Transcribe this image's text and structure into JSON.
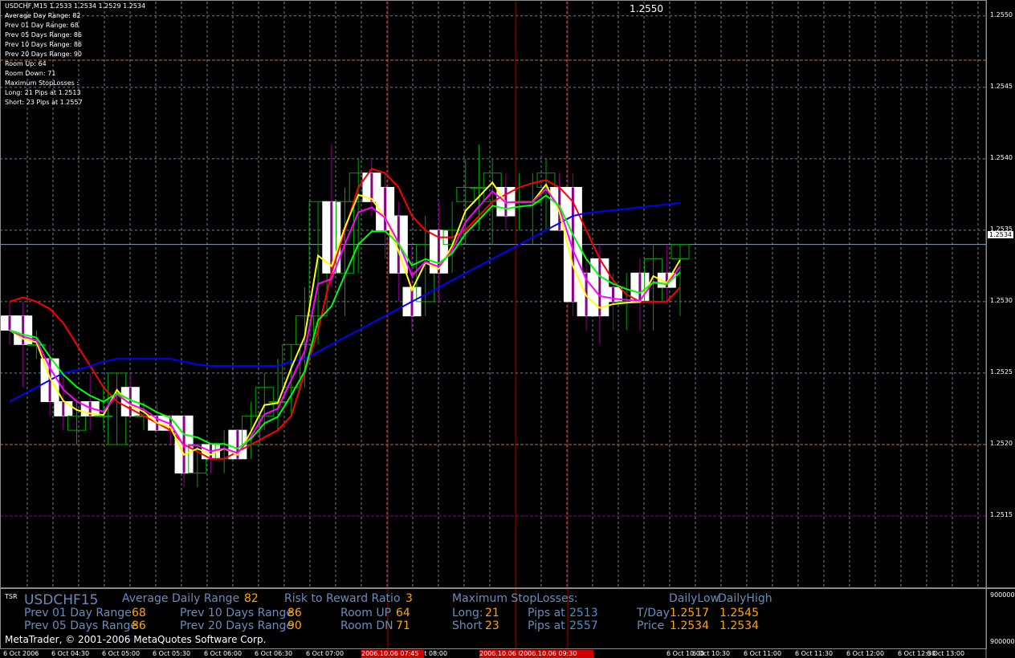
{
  "info_box": {
    "symbol_line": "USDCHF,M15  1.2533 1.2534 1.2529 1.2534",
    "lines": [
      "Average Day  Range: 82",
      "Prev 01  Day  Range: 68",
      "Prev 05  Days Range: 86",
      "Prev 10  Days Range: 86",
      "Prev 20  Days Range: 90",
      "Room Up:     64",
      "Room Down: 71",
      "Maximum StopLosses :",
      "Long:  21 Pips at 1.2513",
      "Short: 23 Pips at 1.2557"
    ]
  },
  "chart_top_price": "1.2550",
  "price_axis": {
    "labels": [
      "1.2550",
      "1.2545",
      "1.2540",
      "1.2535",
      "1.2530",
      "1.2525",
      "1.2520",
      "1.2515"
    ],
    "current_price": "1.2534"
  },
  "subwindow": {
    "label": "TSR",
    "scale_top": "900000",
    "scale_bottom": "900000",
    "symbol": "USDCHF",
    "period": "15",
    "avg_daily_range_label": "Average Daily Range",
    "avg_daily_range_value": "82",
    "rr_label": "Risk to Reward Ratio",
    "rr_value": "3",
    "max_sl_label": "Maximum StopLosses:",
    "daily_low_label": "DailyLow",
    "daily_high_label": "DailyHigh",
    "prev01_label": "Prev 01 Day Range",
    "prev01_value": "68",
    "prev10_label": "Prev 10 Days Range",
    "prev10_value": "86",
    "room_up_label": "Room UP",
    "room_up_value": "64",
    "long_label": "Long:",
    "long_value": "21",
    "pips_at_label": "Pips at",
    "long_price": "2513",
    "tday_label": "T/Day",
    "tday_low": "1.2517",
    "tday_high": "1.2545",
    "prev05_label": "Prev 05 Days Range",
    "prev05_value": "86",
    "prev20_label": "Prev 20 Days Range",
    "prev20_value": "90",
    "room_dn_label": "Room DN",
    "room_dn_value": "71",
    "short_label": "Short",
    "short_value": "23",
    "short_price": "2557",
    "price_label": "Price",
    "price_low": "1.2534",
    "price_high": "1.2534"
  },
  "copyright": "MetaTrader, © 2001-2006 MetaQuotes Software Corp.",
  "time_axis": {
    "labels": [
      "6 Oct 2006",
      "6 Oct 04:30",
      "6 Oct 05:00",
      "6 Oct 05:30",
      "6 Oct 06:00",
      "6 Oct 06:30",
      "6 Oct 07:00",
      "6 Oct 08:00",
      "6 Oct 10:00",
      "6 Oct 10:30",
      "6 Oct 11:00",
      "6 Oct 11:30",
      "6 Oct 12:00",
      "6 Oct 12:30",
      "6 Oct 13:00"
    ],
    "red_labels": [
      "2006.10.06 07:45",
      "2006.10.06 09:00",
      "2006.10.06 09:30"
    ]
  },
  "colors": {
    "background": "#000000",
    "grid": "#708090",
    "bull_candle": "#00a000",
    "bear_candle": "#ffffff",
    "bear_body_fill": "#ffffff",
    "wick_bear": "#8b008b",
    "ma_red": "#ff0000",
    "ma_blue": "#0000ff",
    "ma_yellow": "#ffff00",
    "ma_magenta": "#ff00ff",
    "ma_green": "#00ff00",
    "level_orange": "#b87333",
    "level_purple": "#8b008b",
    "vline_red": "#b00000"
  },
  "chart_data": {
    "type": "candlestick",
    "ylim": [
      1.251,
      1.2551
    ],
    "candles": [
      [
        1.2529,
        1.253,
        1.2527,
        1.2528
      ],
      [
        1.2529,
        1.253,
        1.2524,
        1.2527
      ],
      [
        1.2527,
        1.2528,
        1.2526,
        1.2527
      ],
      [
        1.2526,
        1.2527,
        1.2522,
        1.2523
      ],
      [
        1.2523,
        1.2525,
        1.2521,
        1.2522
      ],
      [
        1.2521,
        1.2523,
        1.252,
        1.2522
      ],
      [
        1.2523,
        1.2525,
        1.2521,
        1.2522
      ],
      [
        1.2522,
        1.2524,
        1.2521,
        1.2522
      ],
      [
        1.252,
        1.2525,
        1.252,
        1.2525
      ],
      [
        1.2524,
        1.2525,
        1.2522,
        1.2522
      ],
      [
        1.2522,
        1.2523,
        1.2521,
        1.2522
      ],
      [
        1.2522,
        1.2523,
        1.2521,
        1.2521
      ],
      [
        1.2522,
        1.2522,
        1.252,
        1.2521
      ],
      [
        1.2522,
        1.2522,
        1.2517,
        1.2518
      ],
      [
        1.2518,
        1.252,
        1.2517,
        1.252
      ],
      [
        1.252,
        1.252,
        1.2518,
        1.2519
      ],
      [
        1.2519,
        1.2521,
        1.2518,
        1.252
      ],
      [
        1.2521,
        1.2521,
        1.2519,
        1.2519
      ],
      [
        1.252,
        1.2523,
        1.2519,
        1.2522
      ],
      [
        1.2522,
        1.2525,
        1.2521,
        1.2524
      ],
      [
        1.2523,
        1.2526,
        1.2521,
        1.2523
      ],
      [
        1.2524,
        1.2527,
        1.2522,
        1.2527
      ],
      [
        1.2527,
        1.2531,
        1.2524,
        1.2529
      ],
      [
        1.2529,
        1.2537,
        1.2527,
        1.2537
      ],
      [
        1.2537,
        1.2541,
        1.2531,
        1.2532
      ],
      [
        1.2532,
        1.2538,
        1.2529,
        1.2537
      ],
      [
        1.2537,
        1.254,
        1.2532,
        1.2539
      ],
      [
        1.2539,
        1.254,
        1.2536,
        1.2537
      ],
      [
        1.2538,
        1.2539,
        1.2533,
        1.2535
      ],
      [
        1.2536,
        1.2537,
        1.253,
        1.2532
      ],
      [
        1.2531,
        1.2534,
        1.2528,
        1.2529
      ],
      [
        1.253,
        1.2536,
        1.2529,
        1.2534
      ],
      [
        1.2535,
        1.2537,
        1.253,
        1.2532
      ],
      [
        1.2534,
        1.2537,
        1.2532,
        1.2535
      ],
      [
        1.2537,
        1.254,
        1.2534,
        1.2538
      ],
      [
        1.2538,
        1.2541,
        1.2535,
        1.2538
      ],
      [
        1.2537,
        1.254,
        1.2534,
        1.2539
      ],
      [
        1.2538,
        1.2539,
        1.2535,
        1.2536
      ],
      [
        1.2537,
        1.2539,
        1.2535,
        1.2537
      ],
      [
        1.2537,
        1.2539,
        1.2534,
        1.2537
      ],
      [
        1.2538,
        1.254,
        1.2535,
        1.2539
      ],
      [
        1.2538,
        1.2539,
        1.2535,
        1.2535
      ],
      [
        1.2538,
        1.2539,
        1.2529,
        1.253
      ],
      [
        1.2532,
        1.2533,
        1.2528,
        1.2529
      ],
      [
        1.2533,
        1.2534,
        1.2527,
        1.2529
      ],
      [
        1.2531,
        1.2532,
        1.2528,
        1.253
      ],
      [
        1.253,
        1.2532,
        1.2528,
        1.253
      ],
      [
        1.2532,
        1.2533,
        1.2528,
        1.253
      ],
      [
        1.253,
        1.2534,
        1.2528,
        1.2533
      ],
      [
        1.2532,
        1.2534,
        1.253,
        1.2531
      ],
      [
        1.2533,
        1.2534,
        1.2529,
        1.2534
      ]
    ],
    "ma_red": [
      1.253,
      1.25303,
      1.253,
      1.25295,
      1.25285,
      1.2527,
      1.25255,
      1.2524,
      1.2523,
      1.25225,
      1.2522,
      1.25215,
      1.2521,
      1.252,
      1.25195,
      1.2519,
      1.2519,
      1.25195,
      1.252,
      1.25205,
      1.2521,
      1.2522,
      1.2525,
      1.2528,
      1.2532,
      1.2535,
      1.2538,
      1.25393,
      1.2539,
      1.2538,
      1.2536,
      1.2535,
      1.25345,
      1.25345,
      1.2535,
      1.2536,
      1.2537,
      1.25375,
      1.2538,
      1.25383,
      1.25385,
      1.2538,
      1.2537,
      1.2535,
      1.2533,
      1.25315,
      1.25305,
      1.253,
      1.253,
      1.253,
      1.2531
    ],
    "ma_blue": [
      1.2523,
      1.25235,
      1.2524,
      1.25245,
      1.2525,
      1.25252,
      1.25255,
      1.25258,
      1.2526,
      1.2526,
      1.2526,
      1.2526,
      1.2526,
      1.25258,
      1.25256,
      1.25255,
      1.25255,
      1.25255,
      1.25255,
      1.25255,
      1.25255,
      1.25258,
      1.2526,
      1.25265,
      1.2527,
      1.25275,
      1.2528,
      1.25285,
      1.2529,
      1.25295,
      1.253,
      1.25305,
      1.2531,
      1.25315,
      1.2532,
      1.25325,
      1.2533,
      1.25335,
      1.2534,
      1.25345,
      1.2535,
      1.25355,
      1.2536,
      1.25362,
      1.25363,
      1.25364,
      1.25365,
      1.25366,
      1.25367,
      1.25368,
      1.25369
    ]
  }
}
